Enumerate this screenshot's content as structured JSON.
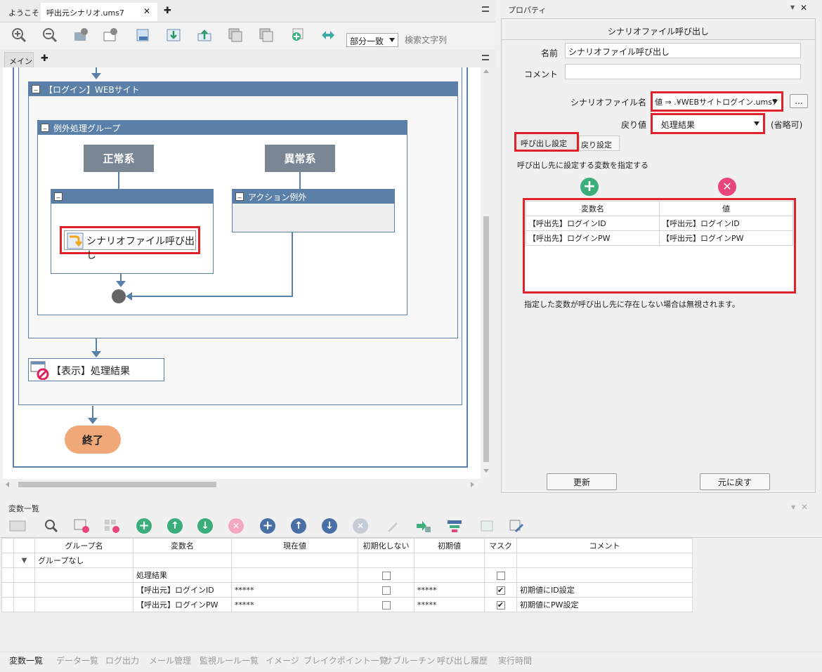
{
  "editor": {
    "tabs": [
      "ようこそ",
      "呼出元シナリオ.ums7"
    ],
    "close_glyph": "✕",
    "add_glyph": "✚",
    "menu_glyph": "▬",
    "match_mode": "部分一致",
    "search_placeholder": "検索文字列",
    "subtabs": [
      "メイン"
    ],
    "flow": {
      "login_group": "【ログイン】WEBサイト",
      "exception_group": "例外処理グループ",
      "normal": "正常系",
      "abnormal": "異常系",
      "action_exception": "アクション例外",
      "scenario_call": "シナリオファイル呼び出し",
      "display_result": "【表示】処理結果",
      "end": "終了",
      "min_glyph": "_"
    }
  },
  "properties": {
    "title": "プロパティ",
    "header": "シナリオファイル呼び出し",
    "name_label": "名前",
    "name_value": "シナリオファイル呼び出し",
    "comment_label": "コメント",
    "comment_value": "",
    "file_label": "シナリオファイル名",
    "file_value": "値 ⇒ .¥WEBサイトログイン.ums7",
    "browse": "...",
    "return_label": "戻り値",
    "return_value": "処理結果",
    "optional": "(省略可)",
    "tab_call": "呼び出し設定",
    "tab_return": "戻り設定",
    "desc": "呼び出し先に設定する変数を指定する",
    "col_name": "変数名",
    "col_value": "値",
    "rows": [
      {
        "name": "【呼出先】ログインID",
        "value": "【呼出元】ログインID"
      },
      {
        "name": "【呼出先】ログインPW",
        "value": "【呼出元】ログインPW"
      }
    ],
    "note": "指定した変数が呼び出し先に存在しない場合は無視されます。",
    "update": "更新",
    "revert": "元に戻す",
    "pin_glyph": "▼",
    "close_glyph": "✕"
  },
  "variables": {
    "title": "変数一覧",
    "headers": [
      "グループ名",
      "変数名",
      "現在値",
      "初期化しない",
      "初期値",
      "マスク",
      "コメント"
    ],
    "group_row": "グループなし",
    "expand_glyph": "▼",
    "check_glyph": "✔",
    "rows": [
      {
        "name": "処理結果",
        "current": "",
        "noinit": false,
        "initial": "",
        "mask": false,
        "comment": ""
      },
      {
        "name": "【呼出元】ログインID",
        "current": "*****",
        "noinit": false,
        "initial": "*****",
        "mask": true,
        "comment": "初期値にID設定"
      },
      {
        "name": "【呼出元】ログインPW",
        "current": "*****",
        "noinit": false,
        "initial": "*****",
        "mask": true,
        "comment": "初期値にPW設定"
      }
    ]
  },
  "bottom_tabs": [
    "変数一覧",
    "データ一覧",
    "ログ出力",
    "メール管理",
    "監視ルール一覧",
    "イメージ",
    "ブレイクポイント一覧",
    "サブルーチン",
    "呼び出し履歴",
    "実行時間"
  ],
  "colors": {
    "accent_red": "#e2202a",
    "group_blue": "#5b80a8",
    "end_orange": "#f0a878",
    "green": "#3cae7c",
    "pink": "#e8457a",
    "blue": "#4a6fa5"
  }
}
